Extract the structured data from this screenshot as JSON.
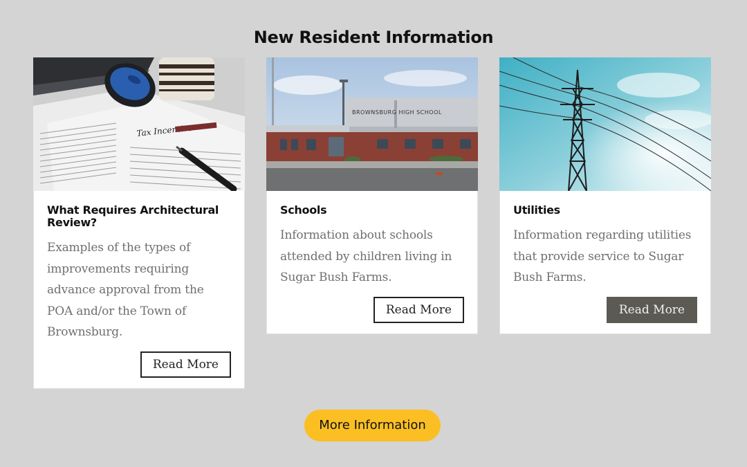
{
  "section": {
    "title": "New Resident Information"
  },
  "cards": [
    {
      "title": "What Requires Architectural Review?",
      "description": "Examples of the types of improvements requiring advance approval from the POA and/or the Town of Brownsburg.",
      "button_label": "Read More",
      "image": "newspaper-with-mouse-and-pen-photo",
      "image_text": "Tax Incentive"
    },
    {
      "title": "Schools",
      "description": "Information about schools attended by children living in Sugar Bush Farms.",
      "button_label": "Read More",
      "image": "high-school-building-photo",
      "image_text": "BROWNSBURG HIGH SCHOOL"
    },
    {
      "title": "Utilities",
      "description": "Information regarding utilities that provide service to Sugar Bush Farms.",
      "button_label": "Read More",
      "image": "power-transmission-tower-photo"
    }
  ],
  "more_info_label": "More Information",
  "colors": {
    "background": "#d4d4d4",
    "accent": "#fbbf24",
    "button_filled": "#5c5b53"
  }
}
